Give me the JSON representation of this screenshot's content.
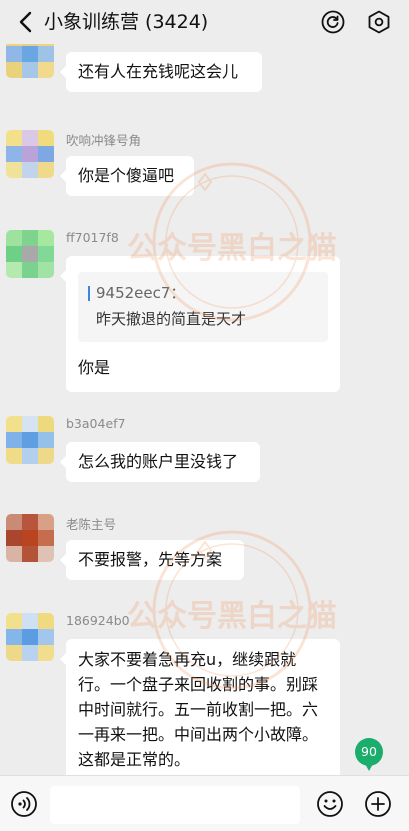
{
  "header": {
    "title": "小象训练营 (3424)",
    "back_icon": "chevron-left-icon",
    "left_action_icon": "refresh-circle-icon",
    "right_action_icon": "settings-hexagon-icon"
  },
  "messages": [
    {
      "sender": "",
      "text": "还有人在充钱呢这会儿",
      "avatar_colors": [
        "#f2d27a",
        "#e6cf8c",
        "#f0d57f",
        "#8fb8e6",
        "#6aa6e2",
        "#9fc3e6",
        "#e8d27c",
        "#a7c7e8",
        "#f1da8e"
      ]
    },
    {
      "sender": "吹响冲锋号角",
      "text": "你是个傻逼吧",
      "avatar_colors": [
        "#f2e08a",
        "#d9c8e6",
        "#f0dc7d",
        "#8fb5e8",
        "#b9a3d8",
        "#7ea8e4",
        "#f1e29a",
        "#c2d4ec",
        "#efd98a"
      ]
    },
    {
      "sender": "ff7017f8",
      "text": "你是",
      "quote": {
        "from": "9452eec7：",
        "text": "昨天撤退的简直是天才"
      },
      "avatar_colors": [
        "#9fe29f",
        "#7fd38f",
        "#a6e8a0",
        "#6ecf86",
        "#a9a9a9",
        "#82d896",
        "#b4eab0",
        "#7ad28e",
        "#a0e3a4"
      ]
    },
    {
      "sender": "b3a04ef7",
      "text": "怎么我的账户里没钱了",
      "avatar_colors": [
        "#f2e08c",
        "#d6e3f0",
        "#efd97f",
        "#7eb2e8",
        "#5f9ee0",
        "#94c0ea",
        "#f0dc88",
        "#b3cfee",
        "#eed889"
      ]
    },
    {
      "sender": "老陈主号",
      "text": "不要报警，先等方案",
      "avatar_colors": [
        "#c98b73",
        "#b8553d",
        "#d9a088",
        "#a9462d",
        "#b8451f",
        "#c56d4e",
        "#d9b3a3",
        "#b35438",
        "#e0c2b4"
      ]
    },
    {
      "sender": "186924b0",
      "text": "大家不要着急再充u，继续跟就行。一个盘子来回收割的事。别踩中时间就行。五一前收割一把。六一再来一把。中间出两个小故障。这都是正常的。",
      "avatar_colors": [
        "#f2e08c",
        "#cfe0f2",
        "#f0da80",
        "#85b6ea",
        "#5c9ce2",
        "#a3c6ec",
        "#eed98a",
        "#b8d2f0",
        "#f1dd8e"
      ]
    }
  ],
  "watermark": {
    "text": "公众号黑白之猫",
    "color": "#f08a4b"
  },
  "unread_badge": "90",
  "input_bar": {
    "voice_icon": "voice-icon",
    "emoji_icon": "emoji-icon",
    "plus_icon": "plus-icon"
  }
}
